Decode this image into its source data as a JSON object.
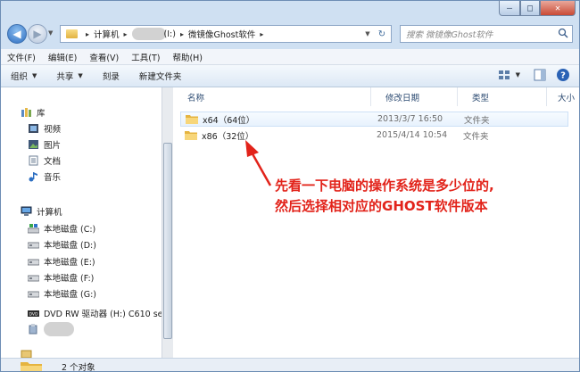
{
  "address": {
    "segments": [
      "计算机",
      "(I:)",
      "微镜像Ghost软件"
    ]
  },
  "search": {
    "placeholder": "搜索 微镜像Ghost软件"
  },
  "menu": [
    "文件(F)",
    "编辑(E)",
    "查看(V)",
    "工具(T)",
    "帮助(H)"
  ],
  "commands": {
    "organize": "组织",
    "share": "共享",
    "burn": "刻录",
    "new_folder": "新建文件夹"
  },
  "sidebar": {
    "library": "库",
    "library_items": [
      "视频",
      "图片",
      "文档",
      "音乐"
    ],
    "computer": "计算机",
    "drives": [
      "本地磁盘 (C:)",
      "本地磁盘 (D:)",
      "本地磁盘 (E:)",
      "本地磁盘 (F:)",
      "本地磁盘 (G:)",
      "DVD RW 驱动器 (H:) C610 se"
    ]
  },
  "columns": {
    "name": "名称",
    "date": "修改日期",
    "type": "类型",
    "size": "大小"
  },
  "files": [
    {
      "name": "x64（64位）",
      "date": "2013/3/7 16:50",
      "type": "文件夹"
    },
    {
      "name": "x86（32位）",
      "date": "2015/4/14 10:54",
      "type": "文件夹"
    }
  ],
  "annotation": {
    "line1": "先看一下电脑的操作系统是多少位的,",
    "line2": "然后选择相对应的GHOST软件版本",
    "color": "#e2231a"
  },
  "status": {
    "count": "2 个对象"
  }
}
